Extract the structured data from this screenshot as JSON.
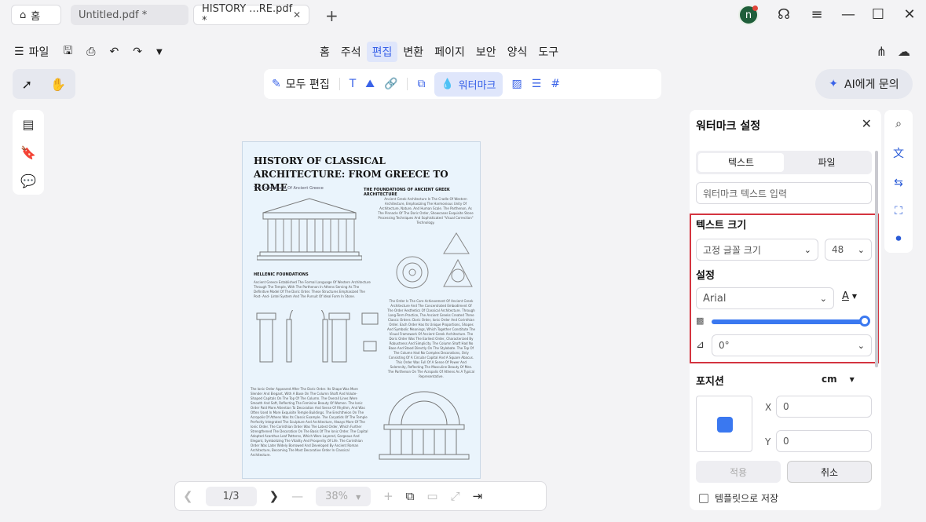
{
  "titlebar": {
    "home_tab": "홈",
    "tabs": [
      {
        "label": "Untitled.pdf *",
        "close": "✕"
      },
      {
        "label": "HISTORY ...RE.pdf *",
        "close": "✕"
      }
    ],
    "avatar_letter": "n"
  },
  "menubar": {
    "file_label": "파일",
    "menus": [
      "홈",
      "주석",
      "편집",
      "변환",
      "페이지",
      "보안",
      "양식",
      "도구"
    ],
    "active_menu": "편집"
  },
  "edit_toolbar": {
    "edit_all_label": "모두 편집",
    "watermark_label": "워터마크"
  },
  "ai_button": {
    "label": "AI에게 문의"
  },
  "document": {
    "title": "HISTORY OF CLASSICAL  ARCHITECTURE: FROM GREECE TO ROME",
    "caption": "The Cornerstone Of Ancient Greece",
    "section1": "THE FOUNDATIONS OF ANCIENT GREEK ARCHITECTURE",
    "section1_text": "Ancient Greek Architecture In The Cradle Of Western Architecture, Emphasizing The Harmonious Unity Of Architecture, Nature, And Human Scale. The Parthenon, As The Pinnacle Of The Doric Order, Showcases Exquisite Stone Processing Techniques And Sophisticated \"Visual Correction\" Technology.",
    "section2": "HELLENIC FOUNDATIONS",
    "section2_text": "Ancient Greece Established The Formal Language Of Western Architecture Through The Temple, With The Parthenon In Athens Serving As The Definitive Model Of The Doric Order. These Structures Emphasized The Post- And- Lintel System And The Pursuit Of Ideal Form In Stone.",
    "section3_text": "The Order Is The Core Achievement Of Ancient Greek Architecture And The Concentrated Embodiment Of The Order Aesthetics Of Classical Architecture. Through Long-Term Practice, The Ancient Greeks Created Three Classic Orders: Doric Order, Ionic Order And Corinthian Order. Each Order Has Its Unique Proportions, Shapes And Symbolic Meanings, Which Together Constitute The Visual Framework Of Ancient Greek Architecture. The Doric Order Was The Earliest Order, Characterized By Robustness And Simplicity. The Column Shaft Had No Base And Stood Directly On The Stylobate. The Top Of The Column Had No Complex Decorations, Only Consisting Of A Circular Capital And A Square Abacus. This Order Was Full Of A Sense Of Power And Solemnity, Reflecting The Masculine Beauty Of Men. The Parthenon On The Acropolis Of Athens As A Typical Representative.",
    "section4_text": "The Ionic Order Appeared After The Doric Order. Its Shape Was More Slender And Elegant, With A Base On The Column Shaft And Volute-Shaped Capitals On The Top Of The Column. The Overall Lines Were Smooth And Soft, Reflecting The Feminine Beauty Of Women. The Ionic Order Paid More Attention To Decoration And Sense Of Rhythm, And Was Often Used In More Exquisite Temple Buildings. The Erechtheion On The Acropolis Of Athens Was Its Classic Example. The Caryatids Of The Temple Perfectly Integrated The Sculpture And Architecture, Always More Of The Ionic Order. The Corinthian Order Was The Latest Order, Which Further Strengthened The Decoration On The Basis Of The Ionic Order. The Capital Adopted Acanthus Leaf Patterns, Which Were Layered, Gorgeous And Elegant, Symbolizing The Vitality And Prosperity Of Life. The Corinthian Order Was Later Widely Borrowed And Developed By Ancient Roman Architecture, Becoming The Most Decorative Order In Classical Architecture."
  },
  "bottomnav": {
    "page": "1/3",
    "zoom": "38%"
  },
  "panel": {
    "title": "워터마크 설정",
    "tab_text": "텍스트",
    "tab_file": "파일",
    "text_placeholder": "워터마크 텍스트 입력",
    "size_label": "텍스트 크기",
    "size_mode": "고정 글꼴 크기",
    "size_value": "48",
    "settings_label": "설정",
    "font": "Arial",
    "rotation": "0°",
    "opacity": 1.0,
    "position_label": "포지션",
    "unit": "cm",
    "x_label": "X",
    "x_value": "0",
    "y_label": "Y",
    "y_value": "0",
    "apply_label": "적용",
    "cancel_label": "취소",
    "save_template_label": "템플릿으로 저장"
  },
  "colors": {
    "accent": "#3a78f0",
    "highlight_border": "#d4343f"
  }
}
